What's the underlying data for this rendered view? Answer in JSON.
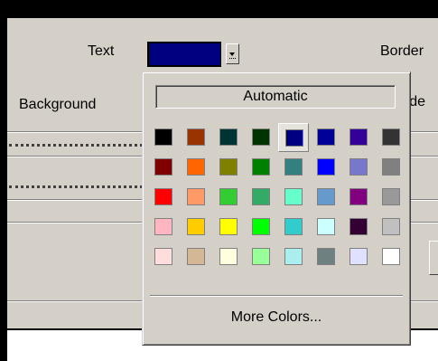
{
  "labels": {
    "text": "Text",
    "background": "Background",
    "border_right": "Border",
    "border_right2": "orde"
  },
  "text_color_picker": {
    "current_color": "#000080"
  },
  "popup": {
    "automatic_label": "Automatic",
    "more_colors_label": "More Colors...",
    "selected_index": 4,
    "colors": [
      "#000000",
      "#993300",
      "#003333",
      "#003300",
      "#000080",
      "#000099",
      "#330099",
      "#333333",
      "#800000",
      "#ff6600",
      "#808000",
      "#008000",
      "#338080",
      "#0000ff",
      "#7777cc",
      "#808080",
      "#ff0000",
      "#ff9966",
      "#33cc33",
      "#33aa66",
      "#66ffcc",
      "#6699cc",
      "#800080",
      "#999999",
      "#ffb6c1",
      "#ffcc00",
      "#ffff00",
      "#00ff00",
      "#33cccc",
      "#ccffff",
      "#330033",
      "#c0c0c0",
      "#ffdddd",
      "#d4b896",
      "#ffffe0",
      "#99ff99",
      "#aaeeee",
      "#6e8080",
      "#e0e0ff",
      "#ffffff"
    ]
  }
}
